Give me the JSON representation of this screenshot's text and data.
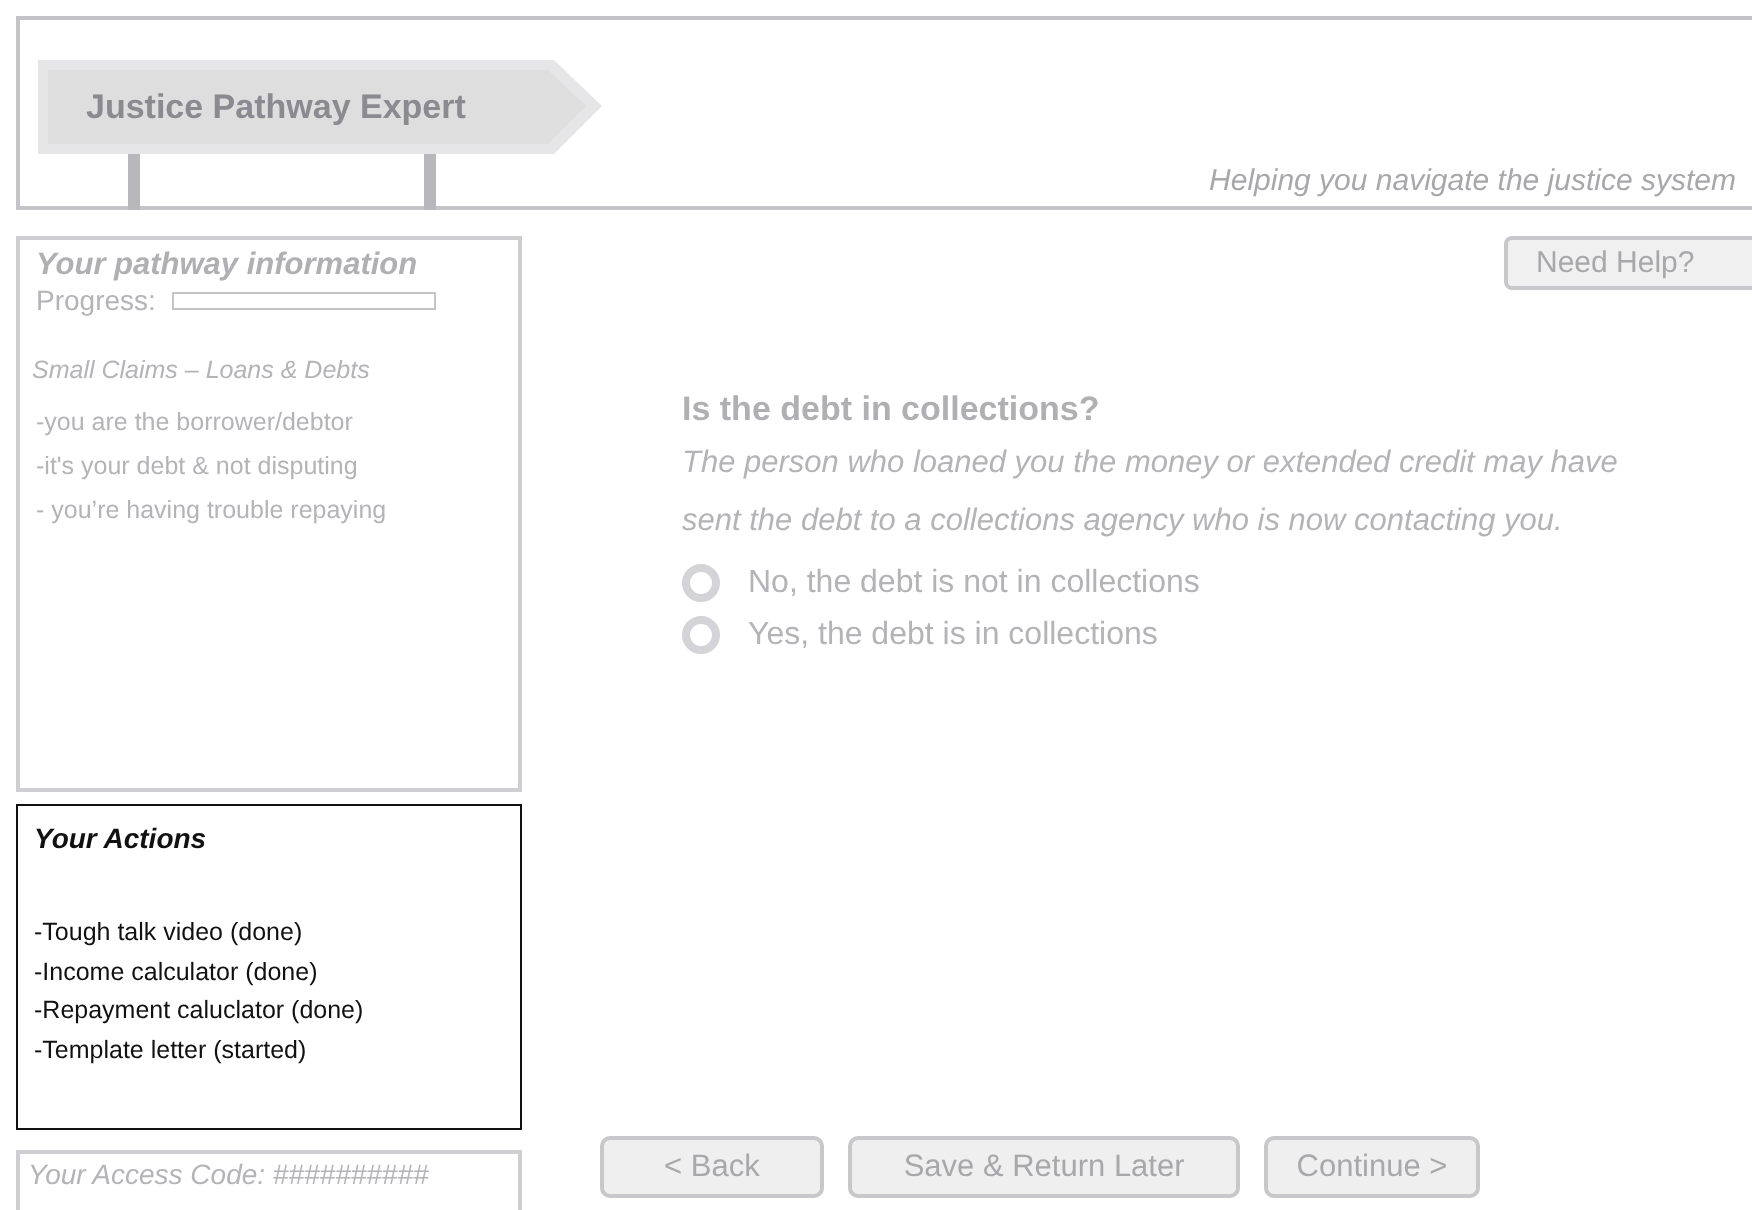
{
  "header": {
    "sign_title": "Justice Pathway Expert",
    "tagline": "Helping you navigate the justice system"
  },
  "pathway": {
    "title": "Your pathway information",
    "progress_label": "Progress:",
    "progress": {
      "level": 0
    },
    "category": "Small Claims – Loans & Debts",
    "facts": [
      "-you are the borrower/debtor",
      "-it's your debt & not disputing",
      "- you’re having trouble repaying"
    ]
  },
  "actions": {
    "title": "Your Actions",
    "items": [
      "-Tough talk video (done)",
      "-Income calculator (done)",
      "-Repayment caluclator (done)",
      "-Template letter (started)"
    ]
  },
  "access_code": "Your Access Code: ##########",
  "help_button": "Need Help?",
  "question": {
    "title": "Is the debt in collections?",
    "description": "The person who loaned you the money or extended credit may have sent the debt to a collections agency who is now contacting you.",
    "options": [
      {
        "label": "No, the debt is not in collections",
        "selected": false
      },
      {
        "label": "Yes, the debt is in collections",
        "selected": false
      }
    ]
  },
  "nav_buttons": [
    "< Back",
    "Save & Return Later",
    "Continue >"
  ]
}
